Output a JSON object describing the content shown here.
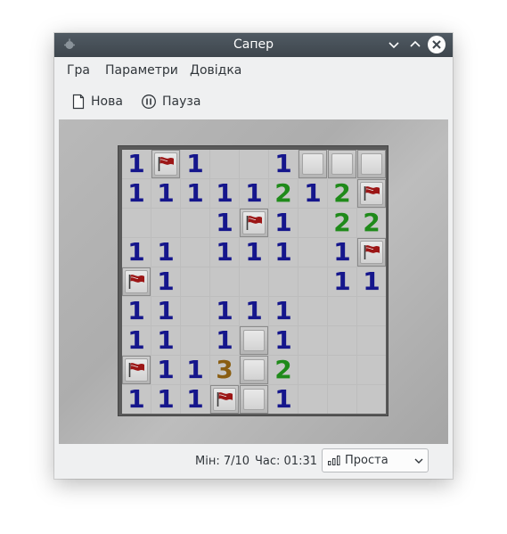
{
  "window": {
    "title": "Сапер"
  },
  "menubar": {
    "items": [
      "Гра",
      "Параметри",
      "Довідка"
    ]
  },
  "toolbar": {
    "new_label": "Нова",
    "pause_label": "Пауза"
  },
  "board": {
    "rows": 9,
    "cols": 9,
    "grid": [
      [
        "1",
        "F",
        "1",
        "",
        "",
        "1",
        "#",
        "#",
        "#"
      ],
      [
        "1",
        "1",
        "1",
        "1",
        "1",
        "2",
        "1",
        "2",
        "F"
      ],
      [
        "",
        "",
        "",
        "1",
        "F",
        "1",
        "",
        "2",
        "2"
      ],
      [
        "1",
        "1",
        "",
        "1",
        "1",
        "1",
        "",
        "1",
        "F"
      ],
      [
        "F",
        "1",
        "",
        "",
        "",
        "",
        "",
        "1",
        "1"
      ],
      [
        "1",
        "1",
        "",
        "1",
        "1",
        "1",
        "",
        "",
        ""
      ],
      [
        "1",
        "1",
        "",
        "1",
        "#",
        "1",
        "",
        "",
        ""
      ],
      [
        "F",
        "1",
        "1",
        "3",
        "#",
        "2",
        "",
        "",
        ""
      ],
      [
        "1",
        "1",
        "1",
        "F",
        "#",
        "1",
        "",
        "",
        ""
      ]
    ],
    "number_colors": {
      "1": "#15168c",
      "2": "#1f8a1a",
      "3": "#8a5e12"
    },
    "flag_color": "#9c1616"
  },
  "status": {
    "mines_text": "Мін: 7/10",
    "time_text": "Час: 01:31"
  },
  "difficulty": {
    "selected": "Проста"
  }
}
